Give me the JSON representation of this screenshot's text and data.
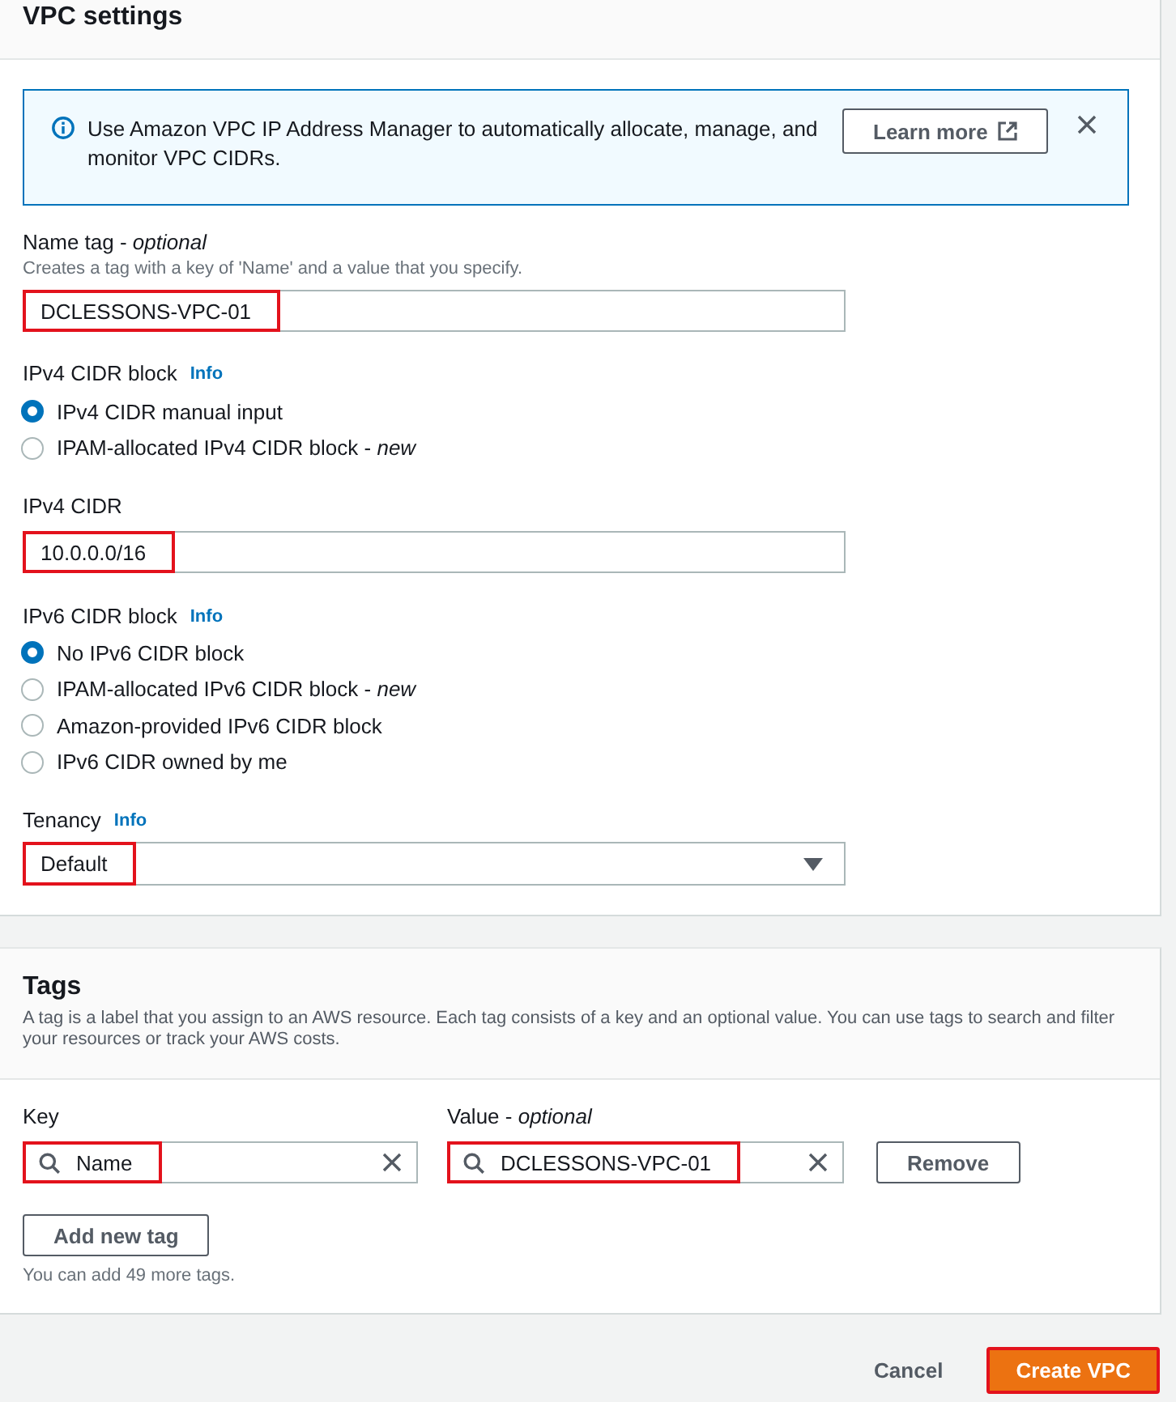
{
  "vpc_settings": {
    "title": "VPC settings",
    "alert": {
      "text": "Use Amazon VPC IP Address Manager to automatically allocate, manage, and monitor VPC CIDRs.",
      "button": "Learn more"
    },
    "name_tag": {
      "label": "Name tag - *optional*",
      "hint": "Creates a tag with a key of 'Name' and a value that you specify.",
      "value": "DCLESSONS-VPC-01",
      "highlighted": true
    },
    "ipv4_cidr_block": {
      "label": "IPv4 CIDR block",
      "info": "Info",
      "options": [
        {
          "label": "IPv4 CIDR manual input",
          "selected": true
        },
        {
          "label": "IPAM-allocated IPv4 CIDR block - *new*",
          "selected": false
        }
      ]
    },
    "ipv4_cidr": {
      "label": "IPv4 CIDR",
      "value": "10.0.0.0/16",
      "highlighted": true
    },
    "ipv6_cidr_block": {
      "label": "IPv6 CIDR block",
      "info": "Info",
      "options": [
        {
          "label": "No IPv6 CIDR block",
          "selected": true
        },
        {
          "label": "IPAM-allocated IPv6 CIDR block - *new*",
          "selected": false
        },
        {
          "label": "Amazon-provided IPv6 CIDR block",
          "selected": false
        },
        {
          "label": "IPv6 CIDR owned by me",
          "selected": false
        }
      ]
    },
    "tenancy": {
      "label": "Tenancy",
      "info": "Info",
      "value": "Default",
      "highlighted": true
    }
  },
  "tags": {
    "title": "Tags",
    "description": "A tag is a label that you assign to an AWS resource. Each tag consists of a key and an optional value. You can use tags to search and filter your resources or track your AWS costs.",
    "key_label": "Key",
    "value_label": "Value - *optional*",
    "rows": [
      {
        "key": "Name",
        "value": "DCLESSONS-VPC-01",
        "key_highlighted": true,
        "value_highlighted": true,
        "remove": "Remove"
      }
    ],
    "add_button": "Add new tag",
    "note": "You can add 49 more tags."
  },
  "footer": {
    "cancel": "Cancel",
    "create": {
      "label": "Create VPC",
      "highlighted": true
    }
  }
}
